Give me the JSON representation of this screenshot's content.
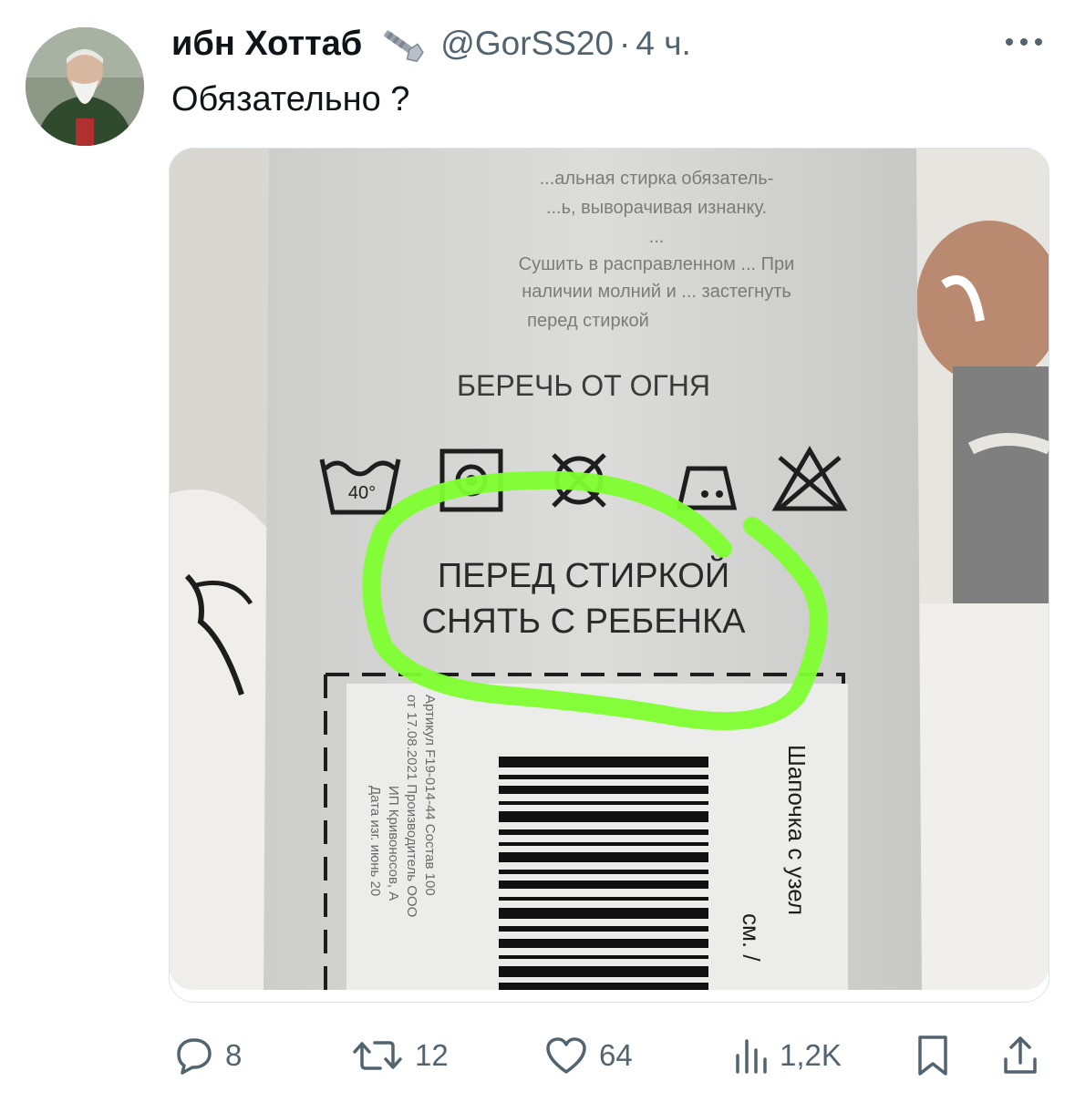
{
  "tweet": {
    "author_name": "ибн Хоттаб",
    "handle": "@GorSS20",
    "separator": "·",
    "time": "4 ч.",
    "text": "Обязательно ?"
  },
  "photo": {
    "label_care_text": [
      "...альная стирка обязатель-",
      "...ь, выворачивая изнанку.",
      "...",
      "Сушить в расправленном ... При",
      "наличии молний и ... застегнуть",
      "перед стиркой"
    ],
    "fire_warning": "БЕРЕЧЬ ОТ ОГНЯ",
    "wash_temp": "40°",
    "highlight_line1": "ПЕРЕД СТИРКОЙ",
    "highlight_line2": "СНЯТЬ С РЕБЕНКА",
    "side_text": "Шапочка с узел",
    "side_text2": "см. /",
    "barcode_col1": "Артикул F19-014-44 Состав 100",
    "barcode_col2": "от 17.08.2021 Производитель ООО",
    "barcode_col3": "ИП Кривоносов, А",
    "barcode_col4": "Дата изг. июнь 20",
    "highlight_color": "#7dff2e"
  },
  "actions": {
    "replies": "8",
    "retweets": "12",
    "likes": "64",
    "views": "1,2K"
  },
  "icons": {
    "badge": "bolt-wrench-icon",
    "more": "more-dots-icon",
    "reply": "comment-icon",
    "retweet": "retweet-icon",
    "like": "heart-icon",
    "views": "bar-chart-icon",
    "bookmark": "bookmark-icon",
    "share": "share-icon"
  }
}
